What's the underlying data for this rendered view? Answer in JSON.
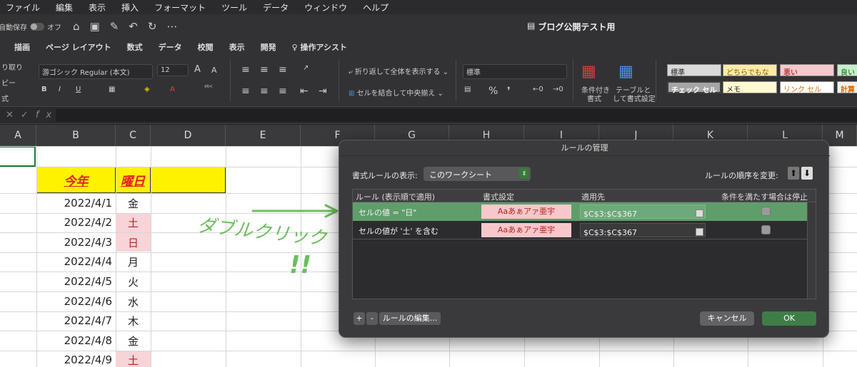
{
  "menubar": [
    "ファイル",
    "編集",
    "表示",
    "挿入",
    "フォーマット",
    "ツール",
    "データ",
    "ウィンドウ",
    "ヘルプ"
  ],
  "titlebar": {
    "autosave": "自動保存",
    "autosave_state": "オフ",
    "doc_title": "ブログ公開テスト用"
  },
  "ribbon_tabs": [
    "描画",
    "ページ レイアウト",
    "数式",
    "データ",
    "校閲",
    "表示",
    "開発",
    "操作アシスト"
  ],
  "ribbon": {
    "clip_1": "り取り",
    "clip_2": "ピー",
    "clip_3": "式",
    "font_name": "游ゴシック Regular (本文)",
    "font_size": "12",
    "wrap_text": "折り返して全体を表示する",
    "merge_center": "セルを結合して中央揃え",
    "number_format": "標準",
    "cond_format_1": "条件付き",
    "cond_format_2": "書式",
    "table_format_1": "テーブルと",
    "table_format_2": "して書式設定",
    "styles": [
      "標準",
      "どちらでもない",
      "悪い",
      "良い",
      "チェック セル",
      "メモ",
      "リンク セル",
      "計算"
    ]
  },
  "colors": {
    "good_row": "#5f9e6a",
    "ok_button": "#3f7d47",
    "header_yellow": "#fff200",
    "header_red": "#e02020",
    "pink": "#f7d4d8"
  },
  "columns": [
    "A",
    "B",
    "C",
    "D",
    "E",
    "F",
    "G",
    "H",
    "I",
    "J",
    "K",
    "L",
    "M"
  ],
  "sheet": {
    "header_b": "今年",
    "header_c": "曜日",
    "rows": [
      {
        "date": "2022/4/1",
        "day": "金",
        "pink": false
      },
      {
        "date": "2022/4/2",
        "day": "土",
        "pink": true
      },
      {
        "date": "2022/4/3",
        "day": "日",
        "pink": true
      },
      {
        "date": "2022/4/4",
        "day": "月",
        "pink": false
      },
      {
        "date": "2022/4/5",
        "day": "火",
        "pink": false
      },
      {
        "date": "2022/4/6",
        "day": "水",
        "pink": false
      },
      {
        "date": "2022/4/7",
        "day": "木",
        "pink": false
      },
      {
        "date": "2022/4/8",
        "day": "金",
        "pink": false
      },
      {
        "date": "2022/4/9",
        "day": "土",
        "pink": true
      }
    ]
  },
  "annotation": {
    "text": "ダブルクリック",
    "exclaim": "!!"
  },
  "dialog": {
    "title": "ルールの管理",
    "show_rules_label": "書式ルールの表示:",
    "show_rules_value": "このワークシート",
    "order_label": "ルールの順序を変更:",
    "headers": [
      "ルール (表示順で適用)",
      "書式設定",
      "適用先",
      "条件を満たす場合は停止"
    ],
    "rules": [
      {
        "rule": "セルの値 = \"日\"",
        "preview": "Aaあぁアァ亜宇",
        "applies": "$C$3:$C$367",
        "selected": true
      },
      {
        "rule": "セルの値が '土' を含む",
        "preview": "Aaあぁアァ亜宇",
        "applies": "$C$3:$C$367",
        "selected": false
      }
    ],
    "add": "+",
    "remove": "-",
    "edit_rule": "ルールの編集...",
    "cancel": "キャンセル",
    "ok": "OK"
  }
}
